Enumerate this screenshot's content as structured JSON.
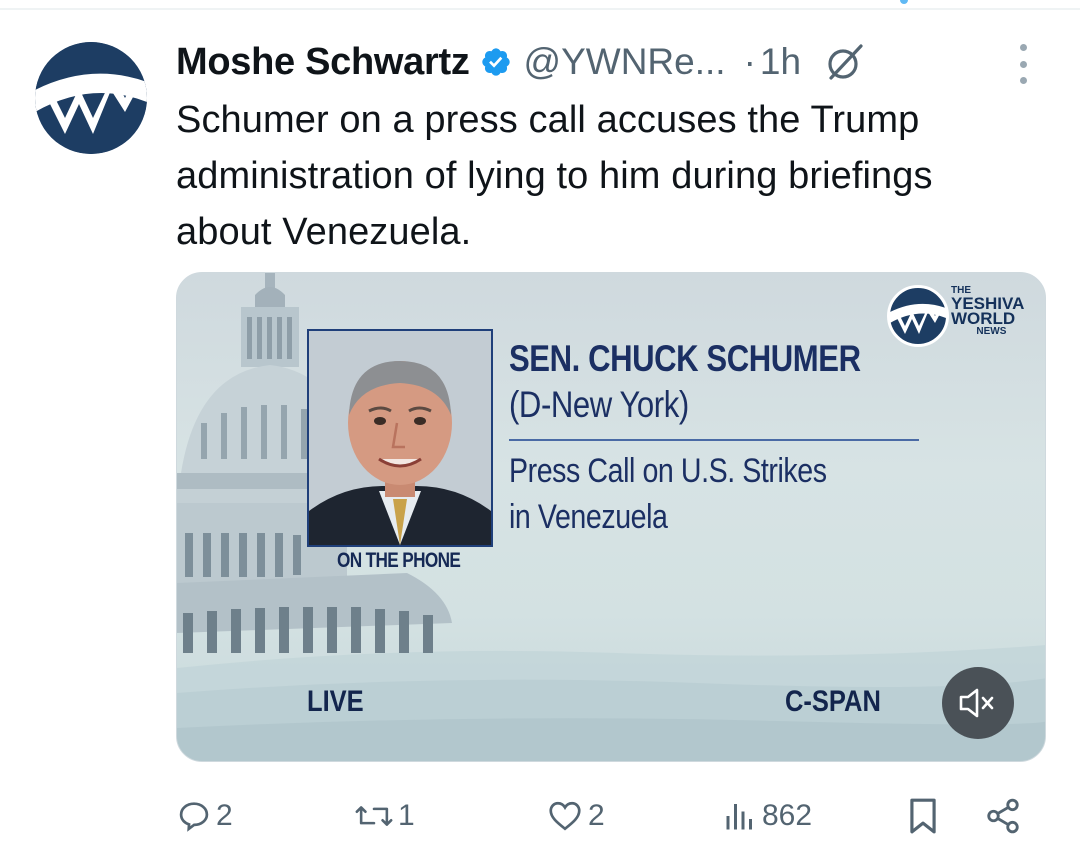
{
  "tweet": {
    "author_name": "Moshe Schwartz",
    "handle": "@YWNRe...",
    "separator": "·",
    "time": "1h",
    "text_line1": "Schumer on a press call accuses the Trump",
    "text_line2": "administration of lying to him during briefings",
    "text_line3": "about Venezuela.",
    "verified": true,
    "icons": {
      "avatar": "ywn-logo-avatar",
      "verified": "verified-badge-icon",
      "grok": "grok-icon",
      "more": "more-options-icon"
    }
  },
  "media": {
    "overlay_name": "SEN. CHUCK SCHUMER",
    "overlay_party": "(D-New York)",
    "overlay_subtitle_line1": "Press Call on U.S. Strikes",
    "overlay_subtitle_line2": "in Venezuela",
    "on_phone": "ON THE PHONE",
    "live": "LIVE",
    "network": "C-SPAN",
    "watermark": {
      "the": "THE",
      "line1": "YESHIVA",
      "line2": "WORLD",
      "line3": "NEWS"
    },
    "mute_icon": "speaker-muted-icon"
  },
  "actions": {
    "reply": {
      "icon": "reply-icon",
      "count": "2"
    },
    "repost": {
      "icon": "repost-icon",
      "count": "1"
    },
    "like": {
      "icon": "like-icon",
      "count": "2"
    },
    "views": {
      "icon": "views-icon",
      "count": "862"
    },
    "bookmark": {
      "icon": "bookmark-icon"
    },
    "share": {
      "icon": "share-icon"
    }
  },
  "colors": {
    "text_primary": "#0f1419",
    "text_secondary": "#536471",
    "verified_blue": "#1d9bf0",
    "caption_navy": "#1b2f63"
  }
}
